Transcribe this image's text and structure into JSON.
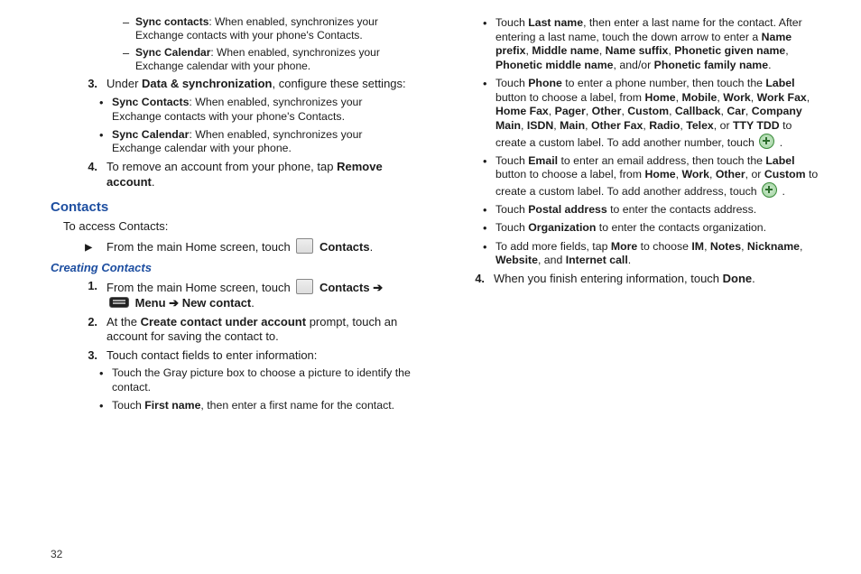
{
  "page_number": "32",
  "col1": {
    "dash1_label": "Sync contacts",
    "dash1_text": ": When enabled, synchronizes your Exchange contacts with your phone's Contacts.",
    "dash2_label": "Sync Calendar",
    "dash2_text": ": When enabled, synchronizes your Exchange calendar with your phone.",
    "step3_num": "3.",
    "step3_a": "Under ",
    "step3_b": "Data & synchronization",
    "step3_c": ", configure these settings:",
    "b1_label": "Sync Contacts",
    "b1_text": ": When enabled, synchronizes your Exchange contacts with your phone's Contacts.",
    "b2_label": "Sync Calendar",
    "b2_text": ": When enabled, synchronizes your Exchange calendar with your phone.",
    "step4_num": "4.",
    "step4_a": "To remove an account from your phone, tap ",
    "step4_b": "Remove account",
    "step4_c": ".",
    "h_contacts": "Contacts",
    "intro": "To access Contacts:",
    "from_home_a": "From the main Home screen, touch ",
    "from_home_b": " Contacts",
    "from_home_c": ".",
    "h_creating": "Creating Contacts",
    "cc_s1_num": "1.",
    "cc_s1_a": "From the main Home screen, touch ",
    "cc_s1_b": " Contacts ",
    "cc_s1_arrow": "➔",
    "cc_s1_menu": " Menu ",
    "cc_s1_arrow2": "➔",
    "cc_s1_new": " New contact",
    "cc_s1_dot": ".",
    "cc_s2_num": "2.",
    "cc_s2_a": "At the ",
    "cc_s2_b": "Create contact under account",
    "cc_s2_c": " prompt, touch an account for saving the contact to.",
    "cc_s3_num": "3.",
    "cc_s3_a": "Touch contact fields to enter information:",
    "cc_b1": "Touch the Gray picture box to choose a picture to identify the contact.",
    "cc_b2_a": "Touch ",
    "cc_b2_b": "First name",
    "cc_b2_c": ", then enter a first name for the contact."
  },
  "col2": {
    "b1_a": "Touch ",
    "b1_b": "Last name",
    "b1_c": ", then enter a last name for the contact. After entering a last name, touch the down arrow to enter a ",
    "b1_d": "Name prefix",
    "b1_e": ", ",
    "b1_f": "Middle name",
    "b1_g": ", ",
    "b1_h": "Name suffix",
    "b1_i": ", ",
    "b1_j": "Phonetic given name",
    "b1_k": ", ",
    "b1_l": "Phonetic middle name",
    "b1_m": ", and/or ",
    "b1_n": "Phonetic family name",
    "b1_o": ".",
    "b2_a": "Touch ",
    "b2_b": "Phone",
    "b2_c": " to enter a phone number, then touch the ",
    "b2_d": "Label",
    "b2_e": " button to choose a label, from ",
    "b2_list": [
      "Home",
      "Mobile",
      "Work",
      "Work Fax",
      "Home Fax",
      "Pager",
      "Other",
      "Custom",
      "Callback",
      "Car",
      "Company Main",
      "ISDN",
      "Main",
      "Other Fax",
      "Radio",
      "Telex"
    ],
    "b2_or": ", or ",
    "b2_tty": "TTY TDD",
    "b2_f": "  to create a custom label. To add another number, touch ",
    "b2_g": " .",
    "b3_a": "Touch ",
    "b3_b": "Email",
    "b3_c": " to enter an email address, then touch the ",
    "b3_d": "Label",
    "b3_e": " button to choose a label, from ",
    "b3_list": [
      "Home",
      "Work",
      "Other"
    ],
    "b3_or": ", or ",
    "b3_custom": "Custom",
    "b3_f": " to create a custom label. To add another address, touch ",
    "b3_g": " .",
    "b4_a": "Touch ",
    "b4_b": "Postal address",
    "b4_c": " to enter the contacts address.",
    "b5_a": "Touch ",
    "b5_b": "Organization",
    "b5_c": " to enter the contacts organization.",
    "b6_a": "To add more fields, tap ",
    "b6_b": "More",
    "b6_c": " to choose ",
    "b6_list": [
      "IM",
      "Notes",
      "Nickname",
      "Website"
    ],
    "b6_and": ", and ",
    "b6_last": "Internet call",
    "b6_d": ".",
    "s4_num": "4.",
    "s4_a": "When you finish entering information, touch ",
    "s4_b": "Done",
    "s4_c": "."
  }
}
